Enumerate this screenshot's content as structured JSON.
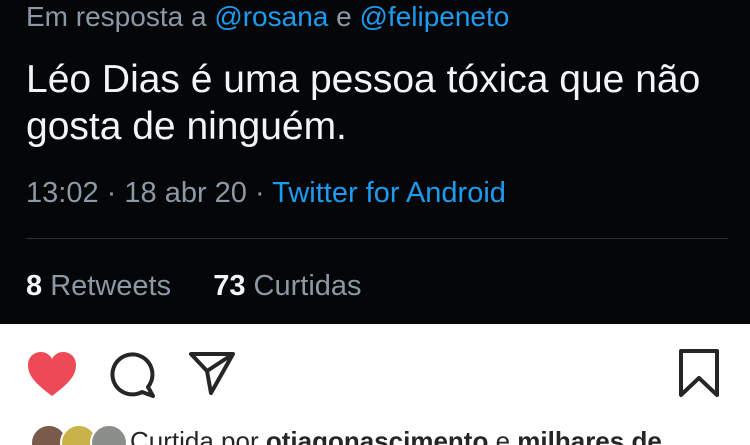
{
  "tweet": {
    "reply_prefix": "Em resposta a",
    "mention_1": "@rosana",
    "reply_and": "e",
    "mention_2": "@felipeneto",
    "text": "Léo Dias é uma pessoa tóxica que não gosta de ninguém.",
    "time": "13:02",
    "separator": "·",
    "date": "18 abr 20",
    "source": "Twitter for Android",
    "retweets_count": "8",
    "retweets_label": "Retweets",
    "likes_count": "73",
    "likes_label": "Curtidas"
  },
  "instagram": {
    "liked_prefix": "Curtida por",
    "liked_user": "otiagonascimento",
    "liked_and": "e",
    "liked_rest": "milhares de",
    "icons": [
      "heart-icon",
      "comment-icon",
      "share-icon",
      "bookmark-icon"
    ],
    "colors": {
      "heart": "#ed4956",
      "icon_stroke": "#262626"
    }
  }
}
